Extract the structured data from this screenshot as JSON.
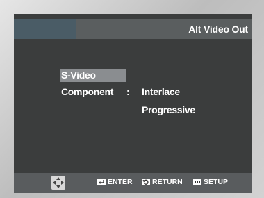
{
  "header": {
    "title": "Alt Video Out"
  },
  "menu": {
    "selected_option": "S-Video",
    "component_label": "Component",
    "separator": ":",
    "sub_options": [
      "Interlace",
      "Progressive"
    ]
  },
  "footer": {
    "enter_label": "ENTER",
    "return_label": "RETURN",
    "setup_label": "SETUP"
  }
}
